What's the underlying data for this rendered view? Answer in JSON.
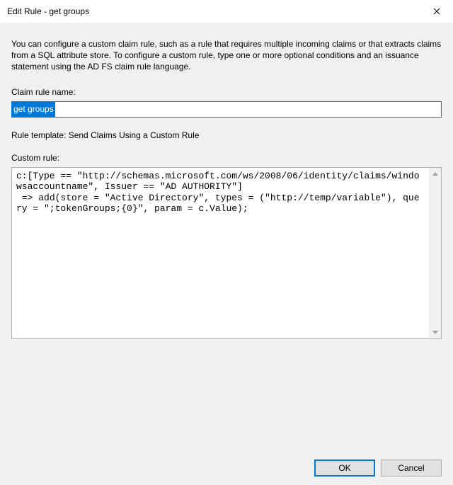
{
  "titlebar": {
    "title": "Edit Rule - get groups"
  },
  "description": "You can configure a custom claim rule, such as a rule that requires multiple incoming claims or that extracts claims from a SQL attribute store. To configure a custom rule, type one or more optional conditions and an issuance statement using the AD FS claim rule language.",
  "labels": {
    "claim_rule_name": "Claim rule name:",
    "rule_template": "Rule template: Send Claims Using a Custom Rule",
    "custom_rule": "Custom rule:"
  },
  "inputs": {
    "claim_rule_name_value": "get groups",
    "custom_rule_value": "c:[Type == \"http://schemas.microsoft.com/ws/2008/06/identity/claims/windowsaccountname\", Issuer == \"AD AUTHORITY\"]\n => add(store = \"Active Directory\", types = (\"http://temp/variable\"), query = \";tokenGroups;{0}\", param = c.Value);"
  },
  "buttons": {
    "ok": "OK",
    "cancel": "Cancel"
  }
}
